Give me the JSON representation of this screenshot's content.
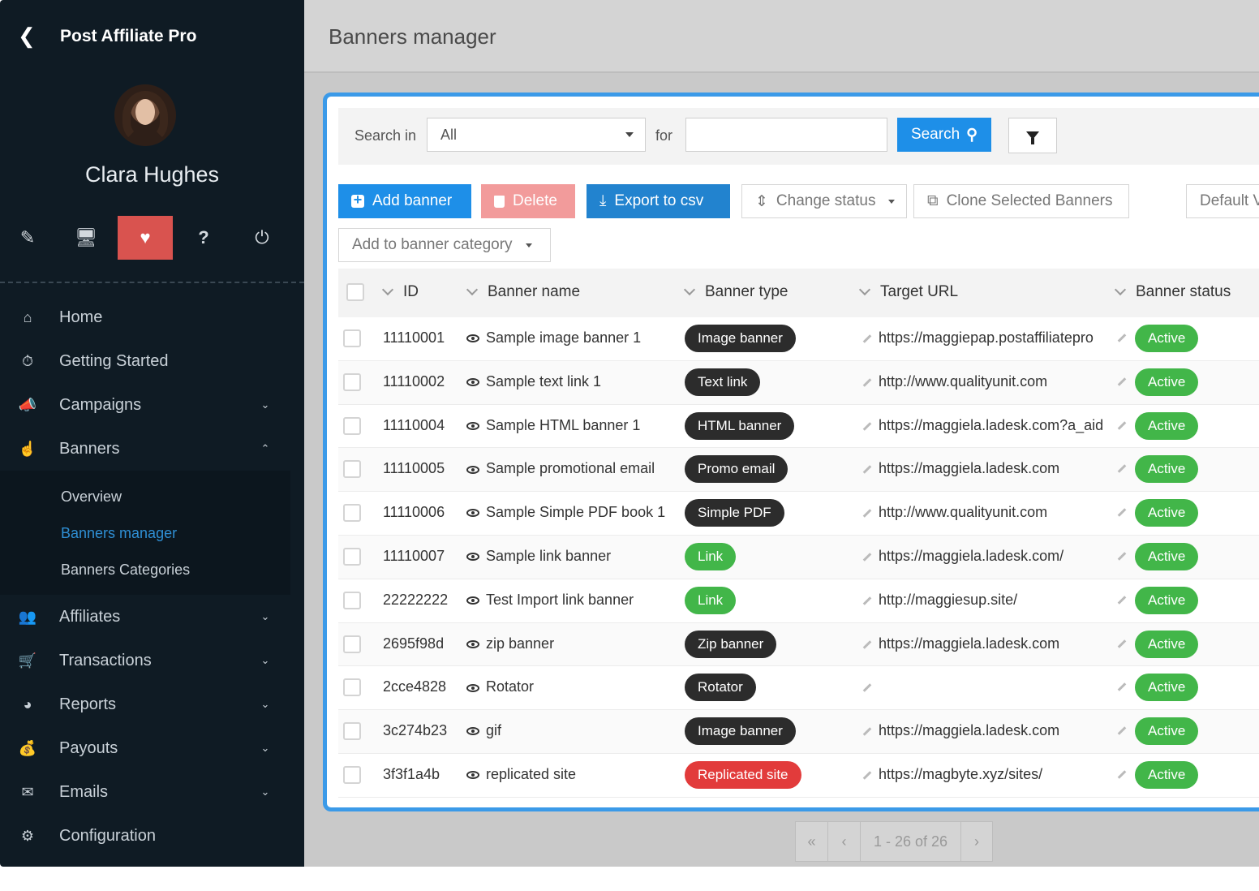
{
  "app": {
    "title": "Post Affiliate Pro"
  },
  "user": {
    "name": "Clara Hughes"
  },
  "tools": [
    "pencil-icon",
    "monitor-icon",
    "heart-pulse-icon",
    "help-icon",
    "power-icon"
  ],
  "nav": {
    "home": "Home",
    "getting_started": "Getting Started",
    "campaigns": "Campaigns",
    "banners": "Banners",
    "banners_sub": {
      "overview": "Overview",
      "manager": "Banners manager",
      "categories": "Banners Categories"
    },
    "affiliates": "Affiliates",
    "transactions": "Transactions",
    "reports": "Reports",
    "payouts": "Payouts",
    "emails": "Emails",
    "configuration": "Configuration"
  },
  "header": {
    "title": "Banners manager"
  },
  "search": {
    "label_in": "Search in",
    "scope": "All",
    "label_for": "for",
    "query": "",
    "button": "Search"
  },
  "toolbar": {
    "add": "Add banner",
    "delete": "Delete",
    "export": "Export to csv",
    "change_status": "Change status",
    "clone": "Clone Selected Banners",
    "default": "Default V",
    "add_category": "Add to banner category"
  },
  "table": {
    "columns": {
      "id": "ID",
      "name": "Banner name",
      "type": "Banner type",
      "url": "Target URL",
      "status": "Banner status"
    },
    "rows": [
      {
        "id": "11110001",
        "name": "Sample image banner 1",
        "type": "Image banner",
        "type_color": "dark",
        "url": "https://maggiepap.postaffiliatepro",
        "status": "Active"
      },
      {
        "id": "11110002",
        "name": "Sample text link 1",
        "type": "Text link",
        "type_color": "dark",
        "url": "http://www.qualityunit.com",
        "status": "Active"
      },
      {
        "id": "11110004",
        "name": "Sample HTML banner 1",
        "type": "HTML banner",
        "type_color": "dark",
        "url": "https://maggiela.ladesk.com?a_aid",
        "status": "Active"
      },
      {
        "id": "11110005",
        "name": "Sample promotional email",
        "type": "Promo email",
        "type_color": "dark",
        "url": "https://maggiela.ladesk.com",
        "status": "Active"
      },
      {
        "id": "11110006",
        "name": "Sample Simple PDF book 1",
        "type": "Simple PDF",
        "type_color": "dark",
        "url": "http://www.qualityunit.com",
        "status": "Active"
      },
      {
        "id": "11110007",
        "name": "Sample link banner",
        "type": "Link",
        "type_color": "green",
        "url": "https://maggiela.ladesk.com/",
        "status": "Active"
      },
      {
        "id": "22222222",
        "name": "Test Import link banner",
        "type": "Link",
        "type_color": "green",
        "url": "http://maggiesup.site/",
        "status": "Active"
      },
      {
        "id": "2695f98d",
        "name": "zip banner",
        "type": "Zip banner",
        "type_color": "dark",
        "url": "https://maggiela.ladesk.com",
        "status": "Active"
      },
      {
        "id": "2cce4828",
        "name": "Rotator",
        "type": "Rotator",
        "type_color": "dark",
        "url": "",
        "status": "Active"
      },
      {
        "id": "3c274b23",
        "name": "gif",
        "type": "Image banner",
        "type_color": "dark",
        "url": "https://maggiela.ladesk.com",
        "status": "Active"
      },
      {
        "id": "3f3f1a4b",
        "name": "replicated site",
        "type": "Replicated site",
        "type_color": "red",
        "url": "https://magbyte.xyz/sites/",
        "status": "Active"
      }
    ]
  },
  "pager": {
    "first": "«",
    "prev": "‹",
    "range": "1 - 26 of 26",
    "next": "›"
  },
  "colors": {
    "sidebar": "#0f1b24",
    "accent": "#1e8fe8",
    "active_tool": "#d9534f",
    "status_green": "#42b649"
  }
}
